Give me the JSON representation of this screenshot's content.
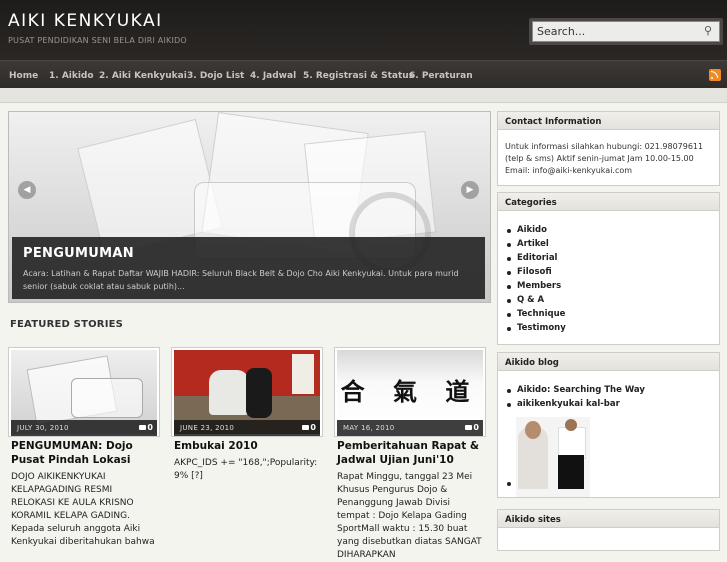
{
  "header": {
    "site_title": "AIKI KENKYUKAI",
    "tagline": "PUSAT PENDIDIKAN SENI BELA DIRI AIKIDO",
    "search_value": "Search...",
    "search_icon": "search-icon"
  },
  "nav": {
    "items": [
      "Home",
      "1. Aikido",
      "2. Aiki Kenkyukai",
      "3. Dojo List",
      "4. Jadwal",
      "5. Registrasi & Status",
      "6. Peraturan"
    ],
    "rss_icon": "rss-icon"
  },
  "slider": {
    "title": "PENGUMUMAN",
    "excerpt": "Acara: Latihan & Rapat Daftar WAJIB HADIR: Seluruh Black Belt & Dojo Cho Aiki Kenkyukai. Untuk para murid senior (sabuk coklat atau sabuk putih)...",
    "prev_icon": "arrow-left-icon",
    "next_icon": "arrow-right-icon"
  },
  "featured": {
    "heading": "FEATURED STORIES",
    "stories": [
      {
        "date": "JULY 30, 2010",
        "comments": "0",
        "title": "PENGUMUMAN: Dojo Pusat Pindah Lokasi",
        "body": "DOJO AIKIKENKYUKAI KELAPAGADING RESMI RELOKASI KE AULA KRISNO KORAMIL KELAPA GADING. Kepada seluruh anggota Aiki Kenkyukai diberitahukan bahwa"
      },
      {
        "date": "JUNE 23, 2010",
        "comments": "0",
        "title": "Embukai 2010",
        "body": "AKPC_IDS += \"168,\";Popularity: 9% [?]"
      },
      {
        "date": "MAY 16, 2010",
        "comments": "0",
        "title": "Pemberitahuan Rapat & Jadwal Ujian Juni'10",
        "body": "Rapat Minggu, tanggal 23 Mei Khusus Pengurus Dojo & Penanggung Jawab Divisi tempat : Dojo Kelapa Gading SportMall waktu : 15.30 buat yang disebutkan diatas SANGAT DIHARAPKAN"
      }
    ],
    "kanji": "合 氣 道"
  },
  "sidebar": {
    "contact": {
      "title": "Contact Information",
      "text": "Untuk informasi silahkan hubungi: 021.98079611 (telp & sms) Aktif senin-jumat Jam 10.00-15.00 Email: info@aiki-kenkyukai.com"
    },
    "categories": {
      "title": "Categories",
      "items": [
        "Aikido",
        "Artikel",
        "Editorial",
        "Filosofi",
        "Members",
        "Q & A",
        "Technique",
        "Testimony"
      ]
    },
    "blog": {
      "title": "Aikido blog",
      "items": [
        "Aikido: Searching The Way",
        "aikikenkyukai kal-bar"
      ]
    },
    "sites": {
      "title": "Aikido sites"
    }
  },
  "colors": {
    "header_bg": "#231f1c",
    "nav_bg": "#34312d",
    "page_bg": "#f4f4ef",
    "rss": "#f08a24"
  }
}
